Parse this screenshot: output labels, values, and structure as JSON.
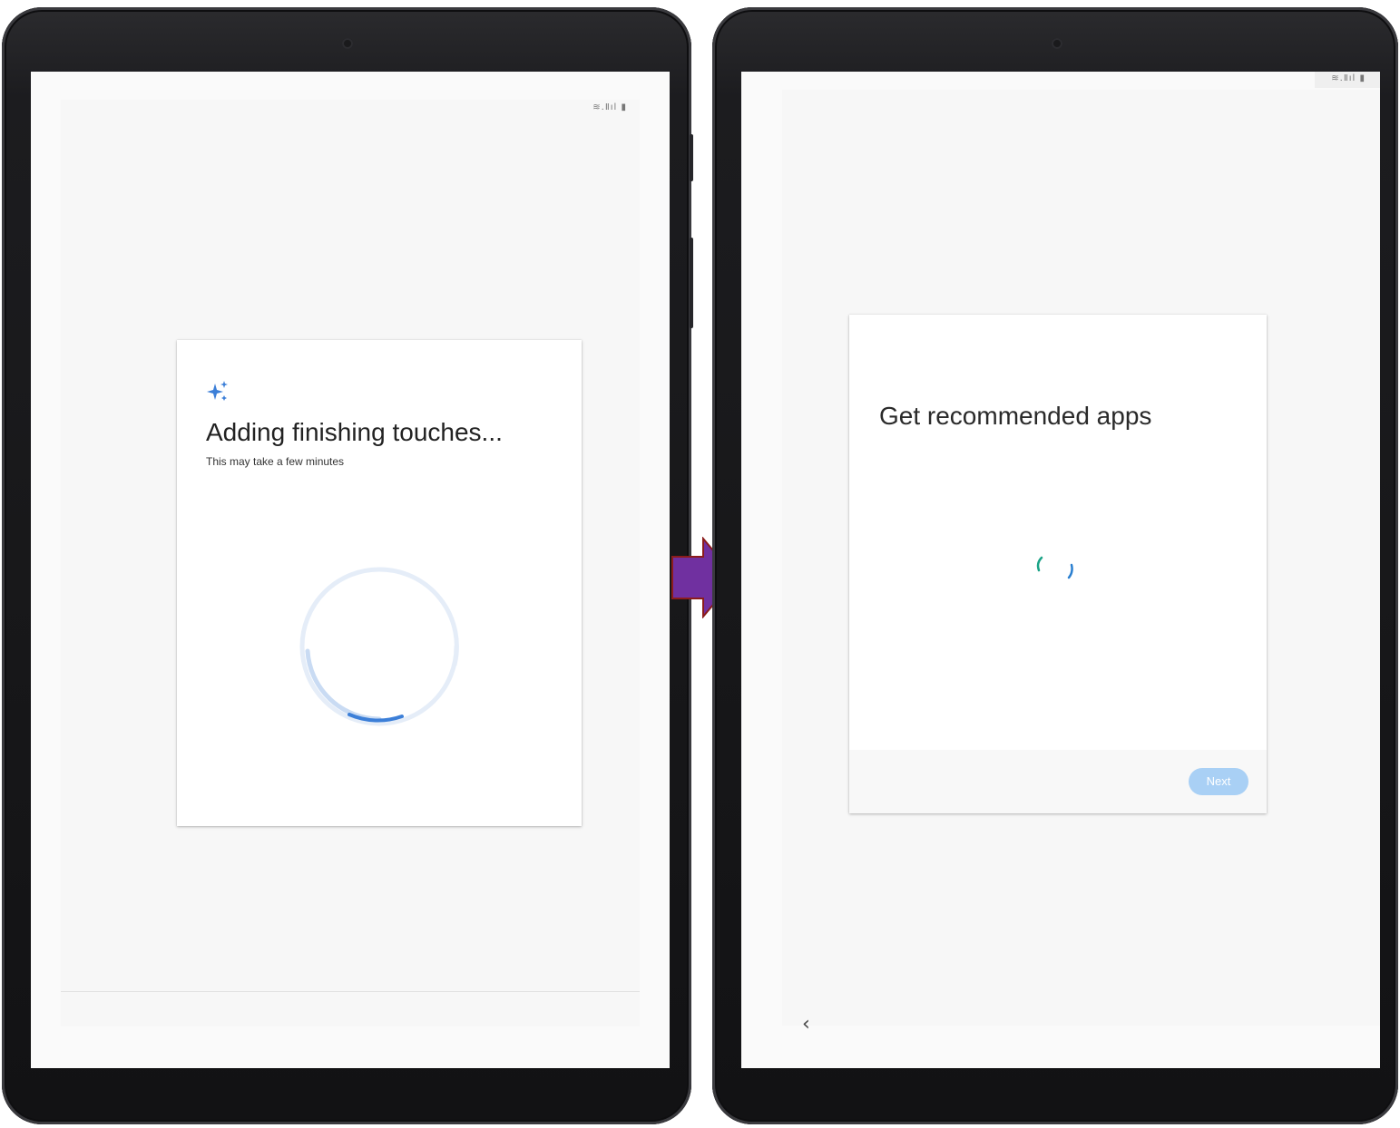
{
  "left_screen": {
    "status_icons": "≋.Ⅱıl ▮",
    "icon": "sparkle-icon",
    "title": "Adding finishing touches...",
    "subtitle": "This may take a few minutes",
    "spinner": "loading-spinner"
  },
  "right_screen": {
    "status_icons": "≋.Ⅱıl ▮",
    "title": "Get recommended apps",
    "spinner": "loading-spinner",
    "next_label": "Next",
    "back_icon": "‹"
  },
  "transition_arrow": "right-arrow",
  "colors": {
    "accent_blue": "#3c7fd8",
    "spinner_light": "#dde8f7",
    "next_button": "#a9d0f5",
    "arrow_fill": "#7030a0",
    "arrow_stroke": "#8b1c1c",
    "spinner_teal": "#1aa386",
    "spinner_blue": "#2a7fd0"
  }
}
